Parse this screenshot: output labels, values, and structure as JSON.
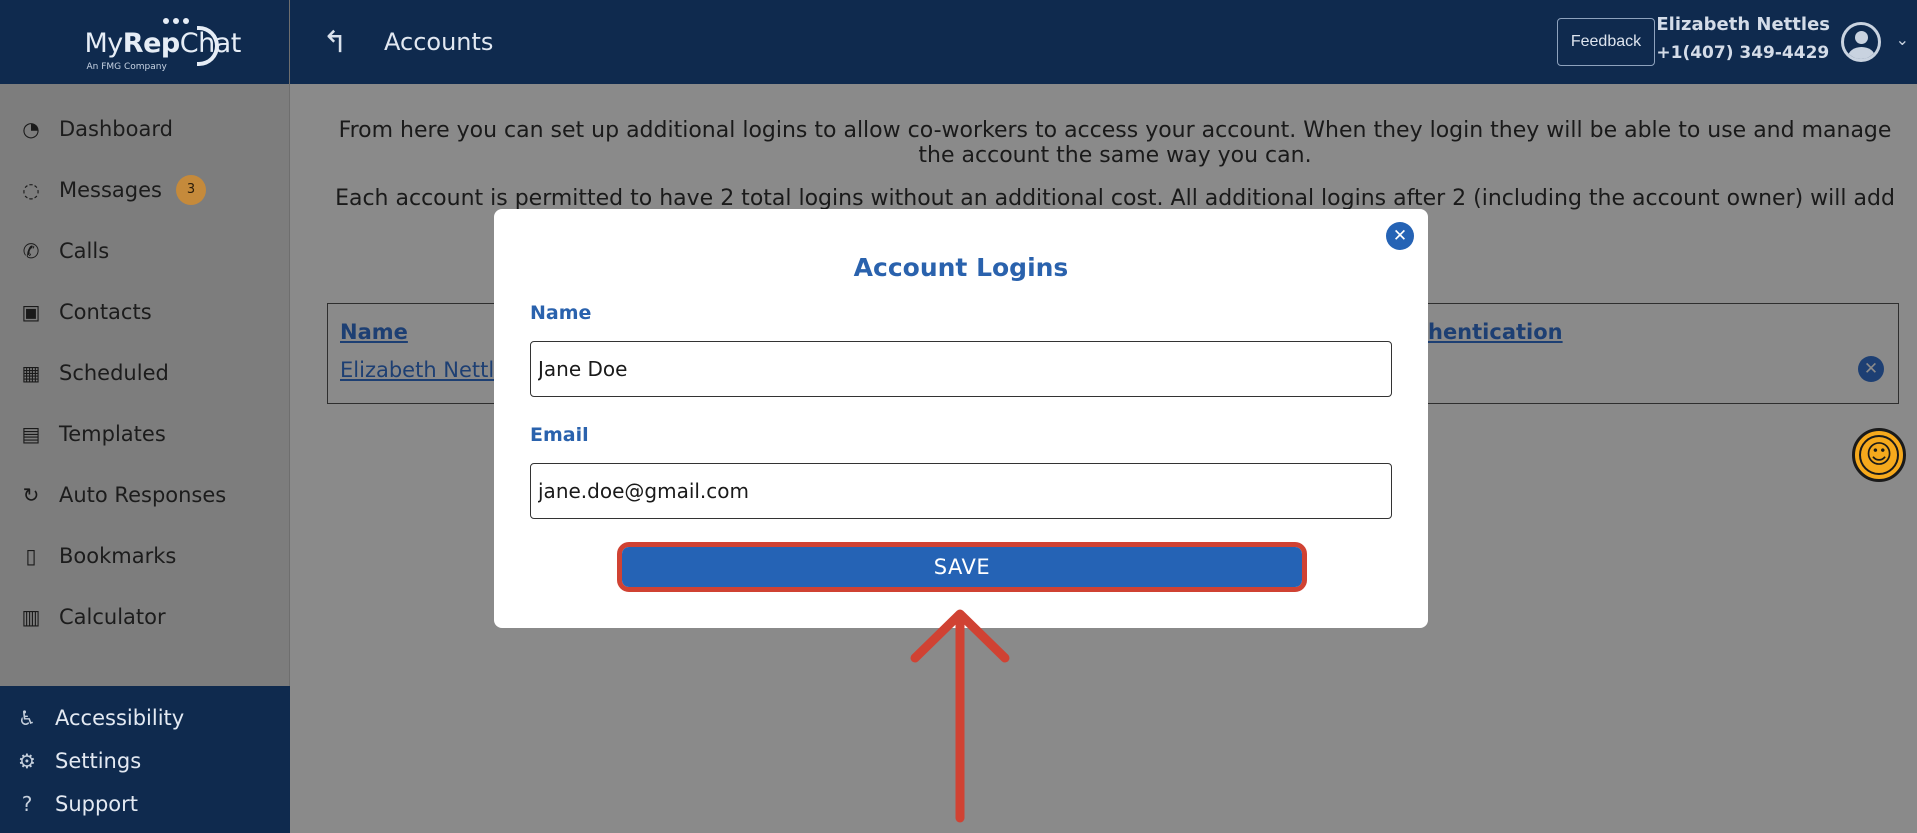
{
  "app": {
    "logo_text_regular": "My",
    "logo_text_bold": "Rep",
    "logo_text_end": "Chat",
    "logo_sub": "An FMG Company"
  },
  "header": {
    "title": "Accounts",
    "back_icon": "back-arrow-icon",
    "feedback_label": "Feedback",
    "user_name": "Elizabeth Nettles",
    "user_phone": "+1(407) 349-4429"
  },
  "sidebar": {
    "items": [
      {
        "label": "Dashboard",
        "icon": "speedometer-icon",
        "glyph": "◔"
      },
      {
        "label": "Messages",
        "icon": "chat-bubble-icon",
        "glyph": "◌",
        "badge": "3"
      },
      {
        "label": "Calls",
        "icon": "phone-icon",
        "glyph": "✆"
      },
      {
        "label": "Contacts",
        "icon": "contact-card-icon",
        "glyph": "▣"
      },
      {
        "label": "Scheduled",
        "icon": "calendar-icon",
        "glyph": "▦"
      },
      {
        "label": "Templates",
        "icon": "document-icon",
        "glyph": "▤"
      },
      {
        "label": "Auto Responses",
        "icon": "refresh-icon",
        "glyph": "↻"
      },
      {
        "label": "Bookmarks",
        "icon": "bookmark-icon",
        "glyph": "▯"
      },
      {
        "label": "Calculator",
        "icon": "calculator-icon",
        "glyph": "▥"
      }
    ],
    "bottom_items": [
      {
        "label": "Accessibility",
        "icon": "accessibility-person-icon",
        "glyph": "♿"
      },
      {
        "label": "Settings",
        "icon": "gear-icon",
        "glyph": "⚙"
      },
      {
        "label": "Support",
        "icon": "help-circle-icon",
        "glyph": "?"
      }
    ]
  },
  "main": {
    "intro_text": "From here you can set up additional logins to allow co-workers to access your account. When they login they will be able to use and manage the account the same way you can.",
    "intro_text_2": "Each account is permitted to have 2 total logins without an additional cost. All additional logins after 2 (including the account owner) will add",
    "table": {
      "headers": [
        "Name",
        "Authentication"
      ],
      "header_auth_visible": "uthentication",
      "rows": [
        {
          "name": "Elizabeth Nettle"
        }
      ]
    }
  },
  "modal": {
    "title": "Account Logins",
    "name_label": "Name",
    "name_value": "Jane Doe",
    "email_label": "Email",
    "email_value": "jane.doe@gmail.com",
    "save_label": "SAVE"
  },
  "colors": {
    "navy": "#0f2a4e",
    "accent_blue": "#2563b5",
    "highlight_red": "#d04233",
    "badge_orange": "#c58a3b",
    "accessibility_yellow": "#f6a91c"
  }
}
